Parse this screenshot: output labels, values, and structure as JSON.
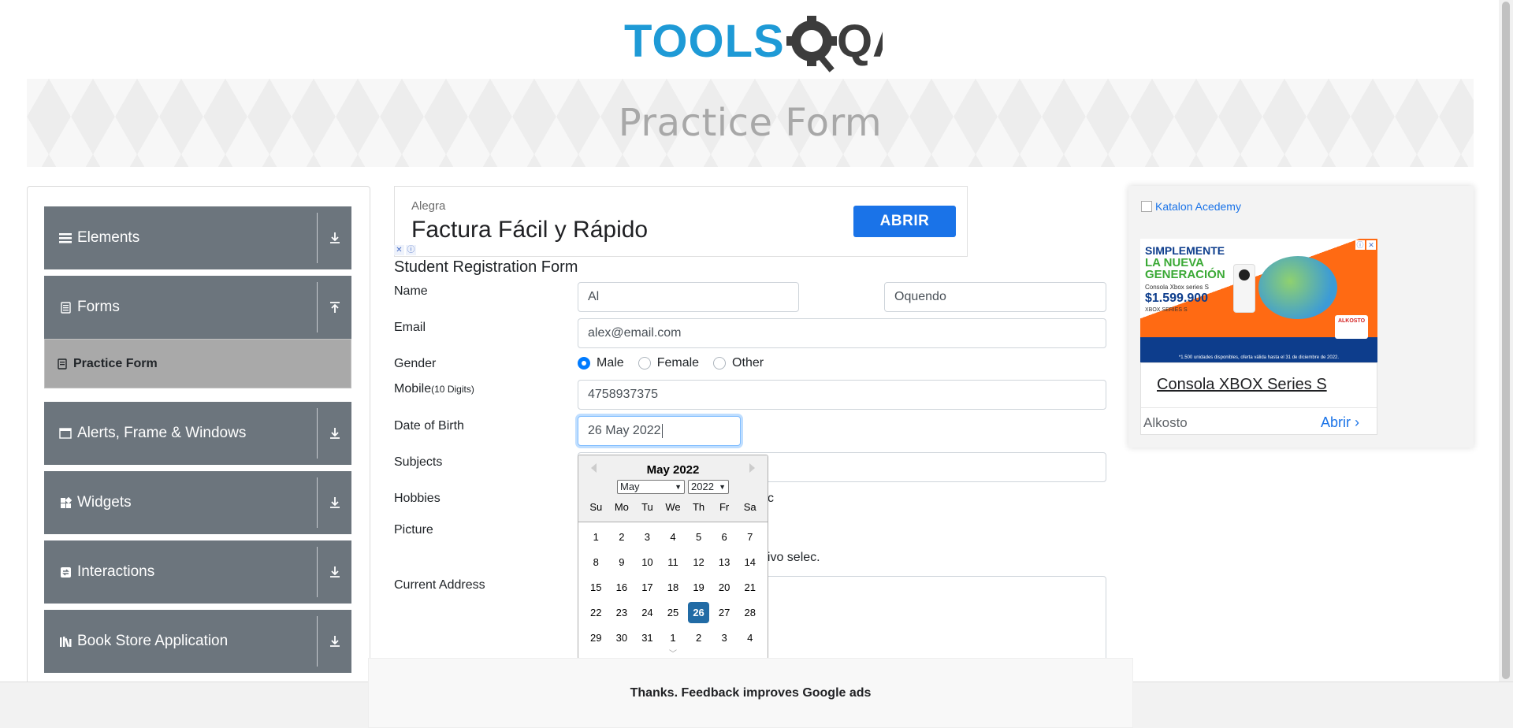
{
  "logo": {
    "text_tools": "TOOLS",
    "text_qa": "QA"
  },
  "banner": {
    "title": "Practice Form"
  },
  "sidebar": {
    "groups": [
      {
        "label": "Elements",
        "icon": "hamburger-icon",
        "arrow": "download-arrow-icon"
      },
      {
        "label": "Forms",
        "icon": "document-icon",
        "arrow": "upload-arrow-icon"
      },
      {
        "label": "Alerts, Frame & Windows",
        "icon": "window-icon",
        "arrow": "download-arrow-icon"
      },
      {
        "label": "Widgets",
        "icon": "widgets-icon",
        "arrow": "download-arrow-icon"
      },
      {
        "label": "Interactions",
        "icon": "interactions-icon",
        "arrow": "download-arrow-icon"
      },
      {
        "label": "Book Store Application",
        "icon": "books-icon",
        "arrow": "download-arrow-icon"
      }
    ],
    "active_item": "Practice Form"
  },
  "ad_top": {
    "brand": "Alegra",
    "headline": "Factura Fácil y Rápido",
    "cta": "ABRIR"
  },
  "form": {
    "title": "Student Registration Form",
    "name_label": "Name",
    "first_name": "Al",
    "last_name": "Oquendo",
    "email_label": "Email",
    "email": "alex@email.com",
    "gender_label": "Gender",
    "gender_options": [
      "Male",
      "Female",
      "Other"
    ],
    "gender_selected": "Male",
    "mobile_label": "Mobile",
    "mobile_hint": "(10 Digits)",
    "mobile": "4758937375",
    "dob_label": "Date of Birth",
    "dob": "26 May 2022",
    "subjects_label": "Subjects",
    "hobbies_label": "Hobbies",
    "hobbies_partial": "c",
    "picture_label": "Picture",
    "picture_partial": "hivo selec.",
    "address_label": "Current Address"
  },
  "datepicker": {
    "title": "May 2022",
    "month_select": "May",
    "year_select": "2022",
    "day_names": [
      "Su",
      "Mo",
      "Tu",
      "We",
      "Th",
      "Fr",
      "Sa"
    ],
    "days": [
      "1",
      "2",
      "3",
      "4",
      "5",
      "6",
      "7",
      "8",
      "9",
      "10",
      "11",
      "12",
      "13",
      "14",
      "15",
      "16",
      "17",
      "18",
      "19",
      "20",
      "21",
      "22",
      "23",
      "24",
      "25",
      "26",
      "27",
      "28",
      "29",
      "30",
      "31",
      "1",
      "2",
      "3",
      "4"
    ],
    "selected_day": "26"
  },
  "ad_right": {
    "image_alt": "Katalon Acedemy",
    "promo_line1": "SIMPLEMENTE",
    "promo_line2": "LA NUEVA GENERACIÓN",
    "promo_product": "Consola Xbox series S",
    "promo_price": "$1.599.900",
    "promo_brand": "XBOX SERIES S",
    "promo_fine": "*1.500 unidades disponibles, oferta válida hasta el 31 de diciembre de 2022.",
    "store_badge": "ALKOSTO",
    "headline": "Consola XBOX Series S",
    "advertiser": "Alkosto",
    "cta": "Abrir"
  },
  "feedback": {
    "text": "Thanks. Feedback improves Google ads"
  },
  "colors": {
    "sidebar_bg": "#6c757d",
    "active_bg": "#a9a9a9",
    "accent": "#1a73e8",
    "selected_day": "#216ba5",
    "radio": "#007bff"
  }
}
